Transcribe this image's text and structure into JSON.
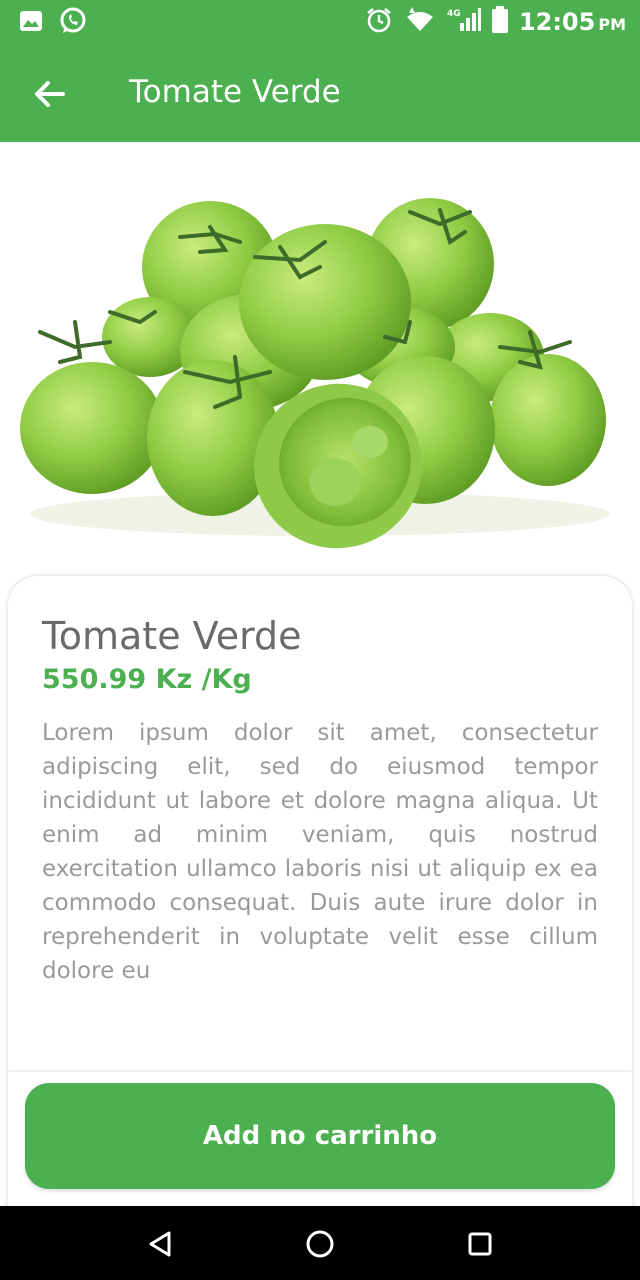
{
  "status_bar": {
    "time": "12:05",
    "ampm": "PM",
    "network": "4G"
  },
  "app_bar": {
    "title": "Tomate Verde"
  },
  "product": {
    "name": "Tomate Verde",
    "price": "550.99 Kz /Kg",
    "description": "Lorem ipsum dolor sit amet, consectetur adipiscing elit, sed do eiusmod tempor incididunt ut labore et dolore magna aliqua. Ut enim ad minim veniam, quis nostrud exercitation ullamco laboris nisi ut aliquip ex ea commodo consequat. Duis aute irure dolor in reprehenderit in voluptate velit esse cillum dolore eu"
  },
  "actions": {
    "add_to_cart_label": "Add no carrinho"
  },
  "colors": {
    "primary": "#4caf50",
    "title_text": "#6a6a6a",
    "body_text": "#9a9a9a"
  },
  "icons": {
    "status_left": [
      "gallery-icon",
      "whatsapp-icon"
    ],
    "status_right": [
      "alarm-icon",
      "wifi-icon",
      "signal-icon",
      "battery-icon"
    ],
    "app_bar": "back-arrow-icon",
    "nav": [
      "nav-back-icon",
      "nav-home-icon",
      "nav-recents-icon"
    ]
  }
}
